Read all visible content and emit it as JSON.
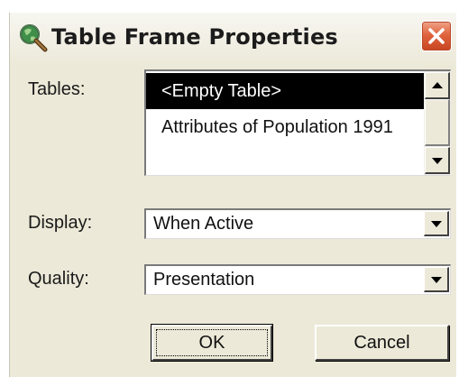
{
  "dialog": {
    "title": "Table Frame Properties",
    "icon": "globe-magnifier-icon",
    "close_icon": "close-icon"
  },
  "tables": {
    "label": "Tables:",
    "items": [
      "<Empty Table>",
      "Attributes of Population 1991"
    ],
    "selected_index": 0
  },
  "display": {
    "label": "Display:",
    "value": "When Active"
  },
  "quality": {
    "label": "Quality:",
    "value": "Presentation"
  },
  "buttons": {
    "ok": "OK",
    "cancel": "Cancel"
  },
  "colors": {
    "dialog_bg": "#ece9d8",
    "selection_bg": "#000000",
    "close_button": "#e0643e"
  }
}
